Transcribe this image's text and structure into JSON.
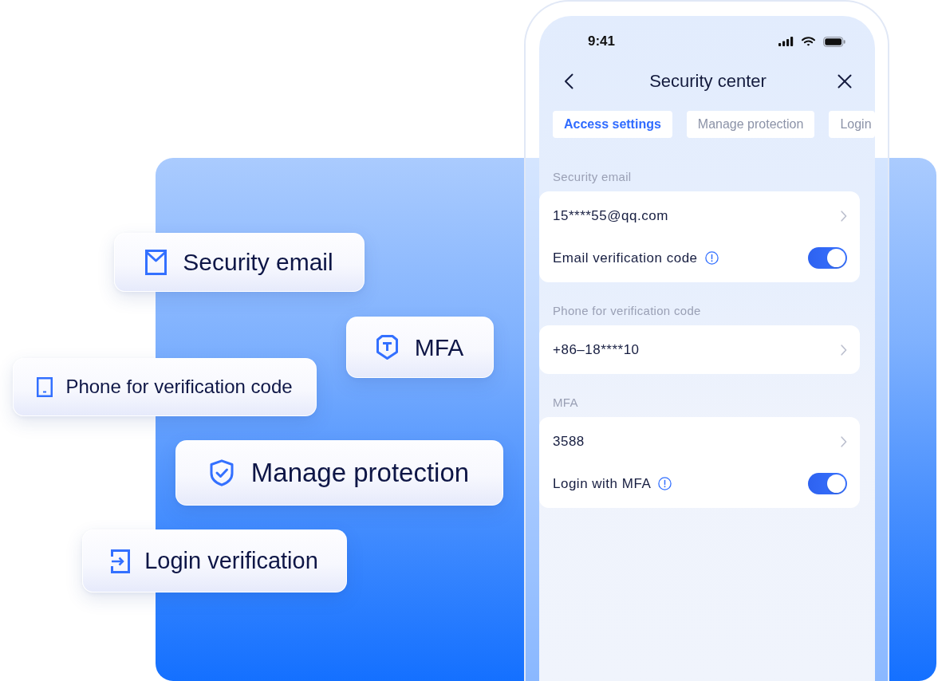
{
  "feature_cards": [
    {
      "kind": "email",
      "label": "Security email"
    },
    {
      "kind": "mfa",
      "label": "MFA"
    },
    {
      "kind": "phone",
      "label": "Phone for verification code"
    },
    {
      "kind": "protection",
      "label": "Manage protection"
    },
    {
      "kind": "login",
      "label": "Login verification"
    }
  ],
  "phone": {
    "status_bar": {
      "time": "9:41"
    },
    "title": "Security center",
    "tabs": [
      {
        "label": "Access settings",
        "selected": true
      },
      {
        "label": "Manage protection",
        "selected": false
      },
      {
        "label": "Login",
        "selected": false
      }
    ],
    "sections": [
      {
        "title": "Security email",
        "rows": [
          {
            "kind": "link",
            "text": "15****55@qq.com"
          },
          {
            "kind": "toggle",
            "text": "Email verification code",
            "on": true
          }
        ]
      },
      {
        "title": "Phone for verification code",
        "rows": [
          {
            "kind": "link",
            "text": "+86–18****10"
          }
        ]
      },
      {
        "title": "MFA",
        "rows": [
          {
            "kind": "link",
            "text": "3588"
          },
          {
            "kind": "toggle",
            "text": "Login with MFA",
            "on": true
          }
        ]
      }
    ]
  }
}
